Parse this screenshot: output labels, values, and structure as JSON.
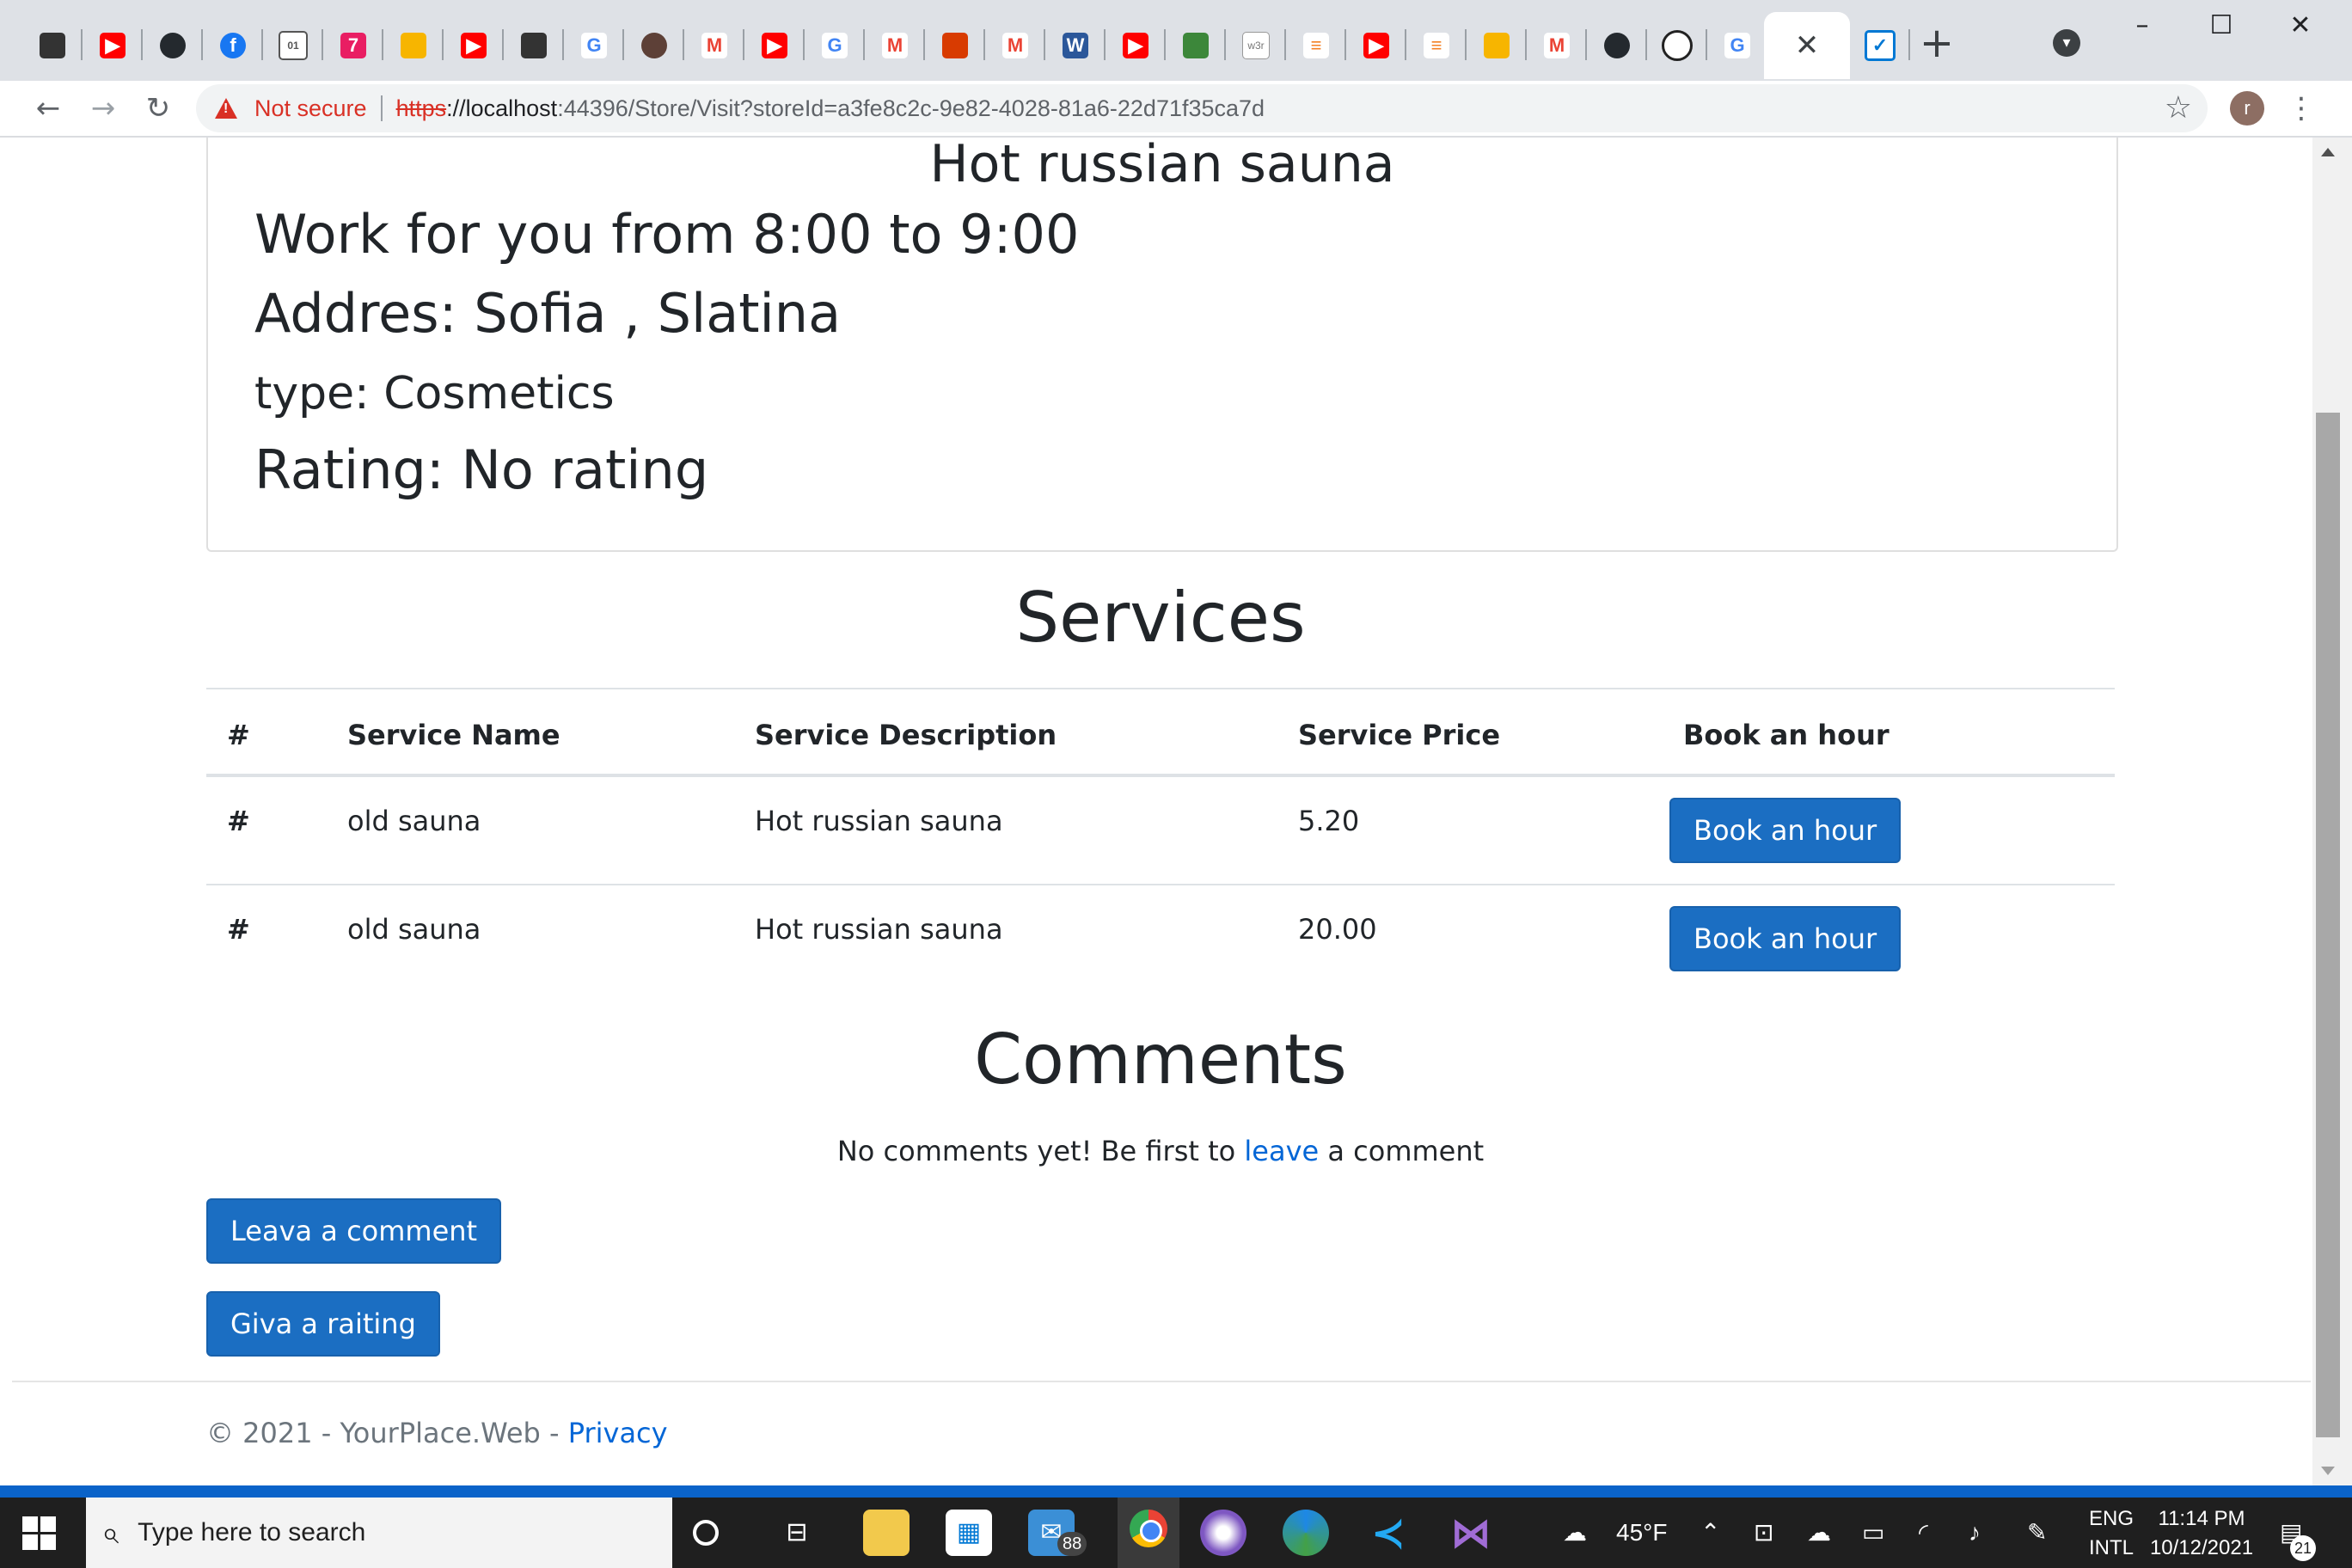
{
  "browser": {
    "tab_icons": [
      "terminal",
      "youtube",
      "github",
      "facebook",
      "binary",
      "seven",
      "stackoverflow-sketch",
      "youtube",
      "terminal",
      "google",
      "sun",
      "gmail",
      "youtube",
      "google",
      "gmail",
      "office",
      "gmail",
      "word",
      "youtube",
      "nodejs",
      "w3r",
      "stackoverflow",
      "youtube",
      "stackoverflow",
      "sketch",
      "gmail",
      "github",
      "globe",
      "google"
    ],
    "active_tab_close": "✕",
    "new_tab": "+",
    "address_bar": {
      "warning_label": "Not secure",
      "url_scheme": "https",
      "url_host": "://localhost",
      "url_rest": ":44396/Store/Visit?storeId=a3fe8c2c-9e82-4028-81a6-22d71f35ca7d"
    },
    "profile_initial": "r"
  },
  "store": {
    "name": "Hot russian sauna",
    "hours": "Work for you from 8:00 to 9:00",
    "address": "Addres: Sofia , Slatina",
    "type": "type: Cosmetics",
    "rating": "Rating: No rating"
  },
  "services": {
    "heading": "Services",
    "columns": [
      "#",
      "Service Name",
      "Service Description",
      "Service Price",
      "Book an hour"
    ],
    "rows": [
      {
        "num": "#",
        "name": "old sauna",
        "description": "Hot russian sauna",
        "price": "5.20",
        "button": "Book an hour"
      },
      {
        "num": "#",
        "name": "old sauna",
        "description": "Hot russian sauna",
        "price": "20.00",
        "button": "Book an hour"
      }
    ]
  },
  "comments": {
    "heading": "Comments",
    "empty_prefix": "No comments yet! Be first to ",
    "empty_link": "leave",
    "empty_suffix": " a comment",
    "leave_button": "Leava a comment",
    "rate_button": "Giva a raiting"
  },
  "footer": {
    "copyright": "© 2021 - YourPlace.Web - ",
    "privacy_link": "Privacy"
  },
  "taskbar": {
    "search_placeholder": "Type here to search",
    "mail_badge": "88",
    "weather": "45°F",
    "language_top": "ENG",
    "language_bottom": "INTL",
    "time": "11:14 PM",
    "date": "10/12/2021",
    "notifications": "21"
  },
  "colors": {
    "primary_button": "#1b6ec2",
    "link": "#0366d6",
    "warning": "#d93025"
  }
}
